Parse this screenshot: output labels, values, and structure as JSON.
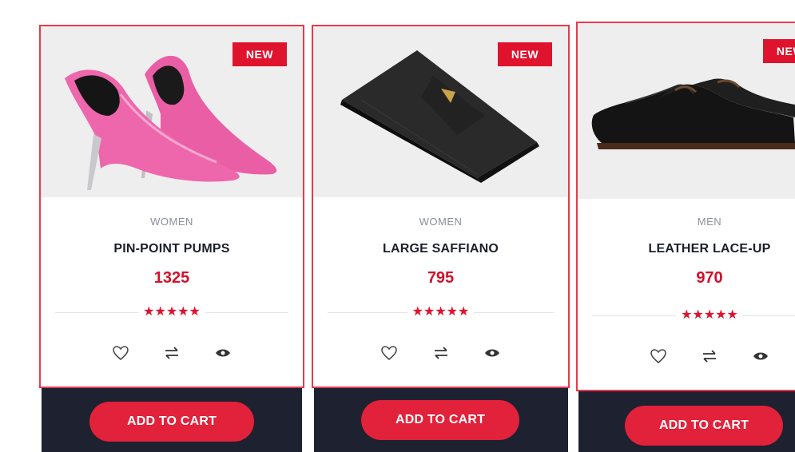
{
  "products": [
    {
      "badge": "NEW",
      "category": "WOMEN",
      "name": "PIN-POINT PUMPS",
      "price": "1325",
      "stars": "★★★★★",
      "cart_label": "ADD TO CART"
    },
    {
      "badge": "NEW",
      "category": "WOMEN",
      "name": "LARGE SAFFIANO",
      "price": "795",
      "stars": "★★★★★",
      "cart_label": "ADD TO CART"
    },
    {
      "badge": "NEW",
      "category": "MEN",
      "name": "LEATHER LACE-UP",
      "price": "970",
      "stars": "★★★★★",
      "cart_label": "ADD TO CART"
    }
  ],
  "icons": {
    "wishlist": "heart-icon",
    "compare": "compare-arrows-icon",
    "quickview": "eye-icon"
  },
  "colors": {
    "accent": "#e0132e",
    "border": "#e8394f",
    "dark_bar": "#1e2130",
    "price": "#d4102a"
  }
}
